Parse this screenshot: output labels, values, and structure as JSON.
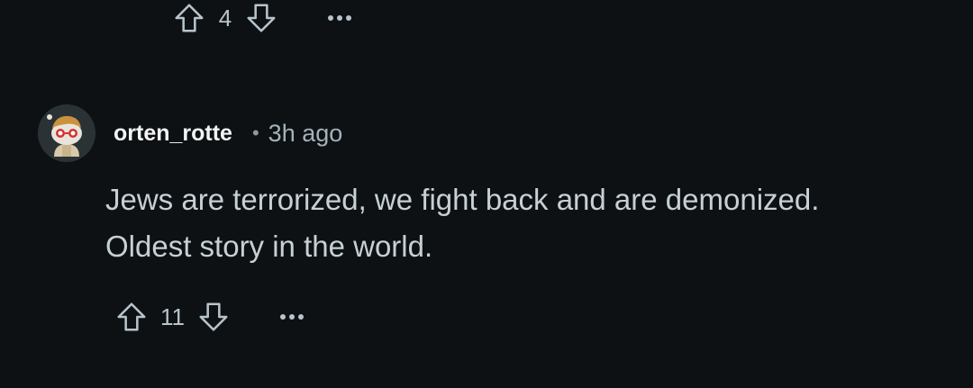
{
  "previous_comment": {
    "vote_count": "4"
  },
  "comment": {
    "username": "orten_rotte",
    "separator": "•",
    "timestamp": "3h ago",
    "body_line1": "Jews are terrorized, we fight back and are demonized.",
    "body_line2": "Oldest story in the world.",
    "vote_count": "11"
  },
  "icons": {
    "upvote": "upvote-arrow-icon",
    "downvote": "downvote-arrow-icon",
    "more": "ellipsis-icon",
    "avatar": "user-avatar"
  },
  "colors": {
    "background": "#0e1113",
    "text": "#c6d0d5",
    "username": "#f2f4f5",
    "meta": "#a4b2ba"
  }
}
